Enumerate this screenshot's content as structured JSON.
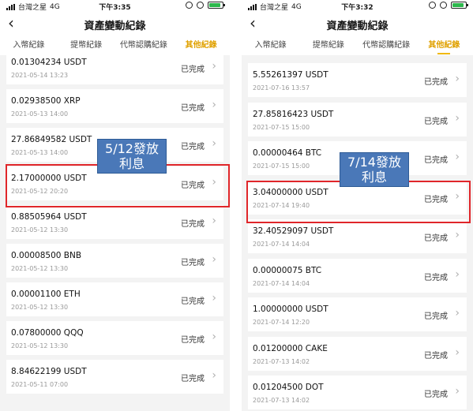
{
  "title": "資產變動紀錄",
  "status_label": "已完成",
  "left": {
    "status_bar": {
      "carrier": "台灣之星",
      "network": "4G",
      "time": "下午3:35"
    },
    "tabs": [
      "入幣紀錄",
      "提幣紀錄",
      "代幣認購紀錄",
      "其他紀錄"
    ],
    "active_tab": "其他紀錄",
    "rows": [
      {
        "amount": "0.01304234 USDT",
        "date": "2021-05-14 13:23"
      },
      {
        "amount": "0.02938500 XRP",
        "date": "2021-05-13 14:00"
      },
      {
        "amount": "27.86849582 USDT",
        "date": "2021-05-13 14:00"
      },
      {
        "amount": "2.17000000 USDT",
        "date": "2021-05-12 20:20"
      },
      {
        "amount": "0.88505964 USDT",
        "date": "2021-05-12 13:30"
      },
      {
        "amount": "0.00008500 BNB",
        "date": "2021-05-12 13:30"
      },
      {
        "amount": "0.00001100 ETH",
        "date": "2021-05-12 13:30"
      },
      {
        "amount": "0.07800000 QQQ",
        "date": "2021-05-12 13:30"
      },
      {
        "amount": "8.84622199 USDT",
        "date": "2021-05-11 07:00"
      }
    ],
    "callout": {
      "line1": "5/12發放",
      "line2": "利息"
    }
  },
  "right": {
    "status_bar": {
      "carrier": "台灣之星",
      "network": "4G",
      "time": "下午3:32"
    },
    "tabs": [
      "入幣紀錄",
      "提幣紀錄",
      "代幣認購紀錄",
      "其他紀錄"
    ],
    "active_tab": "其他紀錄",
    "rows": [
      {
        "amount": "5.55261397 USDT",
        "date": "2021-07-16 13:57"
      },
      {
        "amount": "27.85816423 USDT",
        "date": "2021-07-15 15:00"
      },
      {
        "amount": "0.00000464 BTC",
        "date": "2021-07-15 15:00"
      },
      {
        "amount": "3.04000000 USDT",
        "date": "2021-07-14 19:40"
      },
      {
        "amount": "32.40529097 USDT",
        "date": "2021-07-14 14:04"
      },
      {
        "amount": "0.00000075 BTC",
        "date": "2021-07-14 14:04"
      },
      {
        "amount": "1.00000000 USDT",
        "date": "2021-07-14 12:20"
      },
      {
        "amount": "0.01200000 CAKE",
        "date": "2021-07-13 14:02"
      },
      {
        "amount": "0.01204500 DOT",
        "date": "2021-07-13 14:02"
      }
    ],
    "callout": {
      "line1": "7/14發放",
      "line2": "利息"
    }
  }
}
